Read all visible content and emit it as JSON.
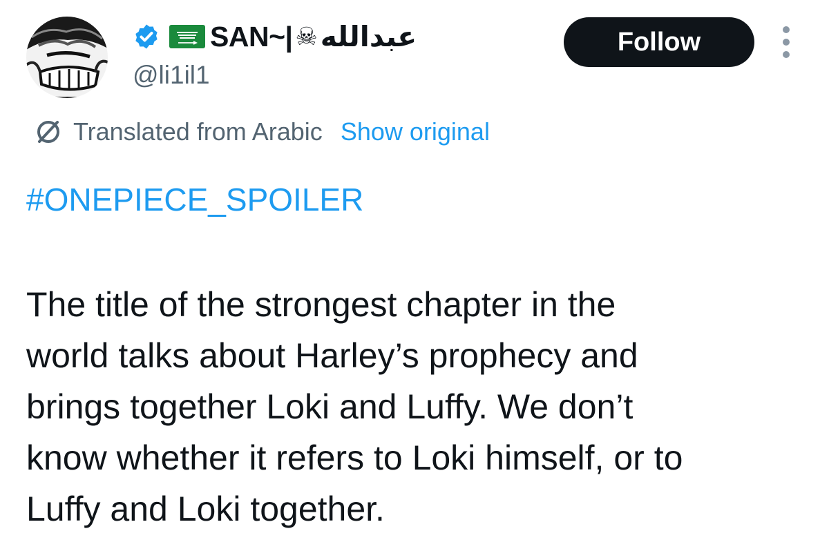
{
  "author": {
    "display_name": "SAN~|",
    "skull_glyph": "☠",
    "arabic_name": "عبدالله",
    "handle": "@li1il1",
    "avatar_icon": "manga-avatar",
    "verified_icon": "verified-badge-icon",
    "flag_icon": "saudi-flag-icon"
  },
  "actions": {
    "follow_label": "Follow",
    "more_icon": "more-options-icon"
  },
  "translation": {
    "icon": "translate-icon",
    "label": "Translated from Arabic",
    "show_original_label": "Show original"
  },
  "tweet": {
    "hashtag": "#ONEPIECE_SPOILER",
    "lines": [
      "The title of the strongest chapter in the",
      "world talks about Harley’s prophecy and",
      "brings together Loki and Luffy. We don’t",
      "know whether it refers to Loki himself, or to",
      "Luffy and Loki together."
    ]
  },
  "colors": {
    "accent_blue": "#1d9bf0",
    "text_primary": "#0f1419",
    "text_secondary": "#536471",
    "button_dark": "#0f1419",
    "flag_green": "#1a8a3c"
  }
}
